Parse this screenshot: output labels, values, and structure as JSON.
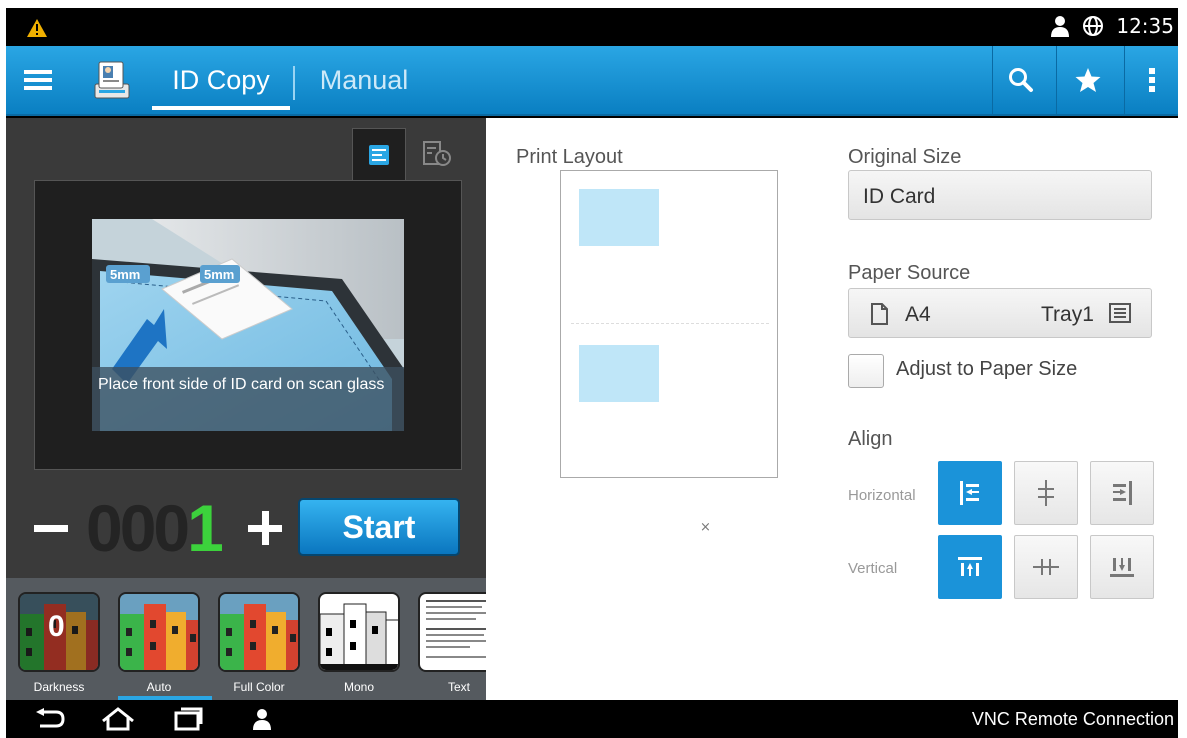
{
  "status_bar": {
    "time": "12:35",
    "icons": [
      "warning-icon",
      "person-icon",
      "globe-icon"
    ]
  },
  "action_bar": {
    "tabs": [
      {
        "label": "ID Copy",
        "active": true
      },
      {
        "label": "Manual",
        "active": false
      }
    ],
    "icons": [
      "menu-icon",
      "id-copy-app-icon",
      "search-icon",
      "star-icon",
      "more-icon"
    ],
    "accent": "#1b93d9"
  },
  "left_panel": {
    "scan_caption": "Place front side of ID card on scan glass",
    "margin_labels": [
      "5mm",
      "5mm"
    ],
    "copies": {
      "dim_digits": "000",
      "lit_digit": "1"
    },
    "start_label": "Start",
    "modes": [
      {
        "label": "Darkness",
        "value": "0",
        "active": false
      },
      {
        "label": "Auto",
        "active": true
      },
      {
        "label": "Full Color",
        "active": false
      },
      {
        "label": "Mono",
        "active": false
      },
      {
        "label": "Text",
        "active": false
      }
    ]
  },
  "right_panel": {
    "print_layout_label": "Print Layout",
    "page_count": "×",
    "original_size": {
      "label": "Original Size",
      "value": "ID Card"
    },
    "paper_source": {
      "label": "Paper Source",
      "size": "A4",
      "tray": "Tray1"
    },
    "adjust": {
      "label": "Adjust to Paper Size",
      "checked": false
    },
    "align": {
      "label": "Align",
      "horizontal_label": "Horizontal",
      "vertical_label": "Vertical",
      "horizontal_selected": "left",
      "vertical_selected": "top"
    }
  },
  "nav_bar": {
    "icons": [
      "back-icon",
      "home-icon",
      "recent-apps-icon",
      "person-icon"
    ],
    "vnc_label": "VNC Remote Connection"
  }
}
